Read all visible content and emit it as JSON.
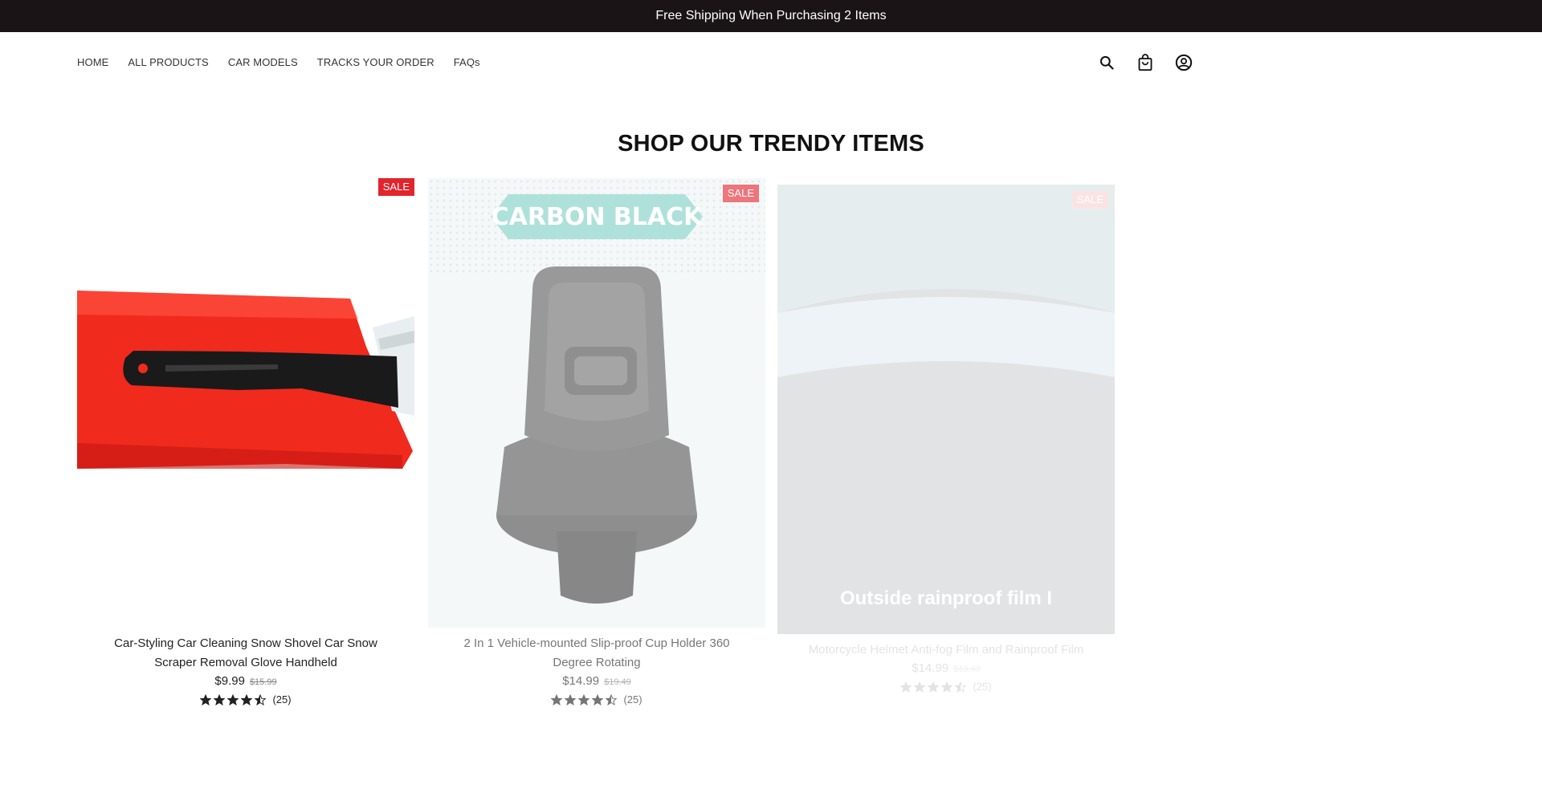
{
  "announcement": {
    "text": "Free Shipping When Purchasing 2 Items"
  },
  "nav": {
    "items": [
      "HOME",
      "ALL PRODUCTS",
      "CAR MODELS",
      "TRACKS YOUR ORDER",
      "FAQs"
    ]
  },
  "header_icons": [
    "search-icon",
    "cart-icon",
    "account-icon"
  ],
  "section": {
    "title": "SHOP OUR TRENDY ITEMS"
  },
  "products": [
    {
      "badge": "SALE",
      "title": "Car-Styling Car Cleaning Snow Shovel Car Snow Scraper Removal Glove Handheld",
      "price": "$9.99",
      "compare_price": "$15.99",
      "rating": 4.5,
      "review_count": "(25)"
    },
    {
      "badge": "SALE",
      "image_text": "CARBON BLACK",
      "title": "2 In 1 Vehicle-mounted Slip-proof Cup Holder 360 Degree Rotating",
      "price": "$14.99",
      "compare_price": "$19.49",
      "rating": 4.5,
      "review_count": "(25)"
    },
    {
      "badge": "SALE",
      "image_text": "Outside rainproof film I",
      "title": "Motorcycle Helmet Anti-fog Film and Rainproof Film",
      "price": "$14.99",
      "compare_price": "$19.49",
      "rating": 4.5,
      "review_count": "(25)"
    }
  ],
  "colors": {
    "announcement_bg": "#1b1416",
    "sale_badge": "#e2242c",
    "banner_teal": "#7fd0c6"
  }
}
